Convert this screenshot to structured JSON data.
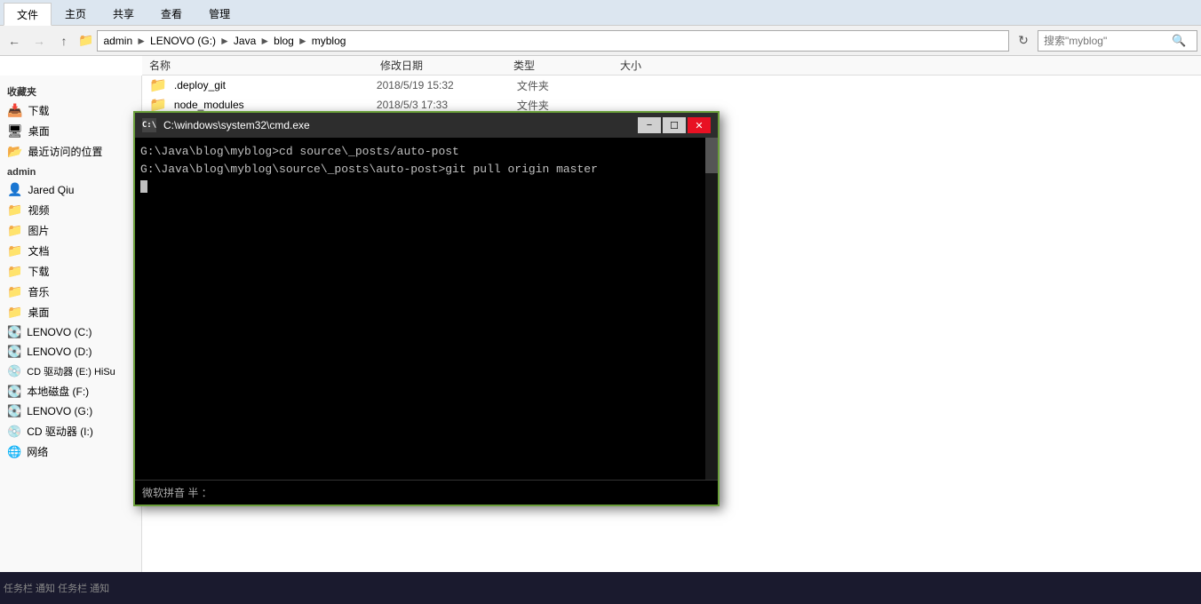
{
  "window": {
    "title": "myblog"
  },
  "ribbon": {
    "tabs": [
      "文件",
      "主页",
      "共享",
      "查看",
      "管理"
    ]
  },
  "addressBar": {
    "backDisabled": false,
    "forwardDisabled": true,
    "upDisabled": false,
    "path": [
      "admin",
      "LENOVO (G:)",
      "Java",
      "blog",
      "myblog"
    ],
    "searchPlaceholder": "搜索\"myblog\""
  },
  "columns": {
    "name": "名称",
    "date": "修改日期",
    "type": "类型",
    "size": "大小"
  },
  "sidebar": {
    "pinned": {
      "title": "收藏夹",
      "items": [
        "下载",
        "桌面",
        "最近访问的位置"
      ]
    },
    "user": {
      "name": "admin",
      "subItems": [
        "Jared Qiu",
        "视频",
        "图片",
        "文档",
        "下载",
        "音乐",
        "桌面"
      ]
    },
    "drives": [
      "LENOVO (C:)",
      "LENOVO (D:)",
      "CD 驱动器 (E:) HiSu",
      "本地磁盘 (F:)",
      "LENOVO (G:)",
      "CD 驱动器 (I:)"
    ],
    "network": "网络"
  },
  "files": [
    {
      "name": ".deploy_git",
      "date": "2018/5/19 15:32",
      "type": "文件夹",
      "size": ""
    },
    {
      "name": "node_modules",
      "date": "2018/5/3 17:33",
      "type": "文件夹",
      "size": ""
    }
  ],
  "cmd": {
    "title": "C:\\windows\\system32\\cmd.exe",
    "iconLabel": "cmd",
    "line1": "G:\\Java\\blog\\myblog>cd source\\_posts/auto-post",
    "line2": "G:\\Java\\blog\\myblog\\source\\_posts\\auto-post>git pull origin master",
    "statusbar": "微软拼音  半  ："
  },
  "taskbar": {
    "items": [
      "任务栏",
      "通知",
      "任务栏",
      "通知"
    ]
  }
}
